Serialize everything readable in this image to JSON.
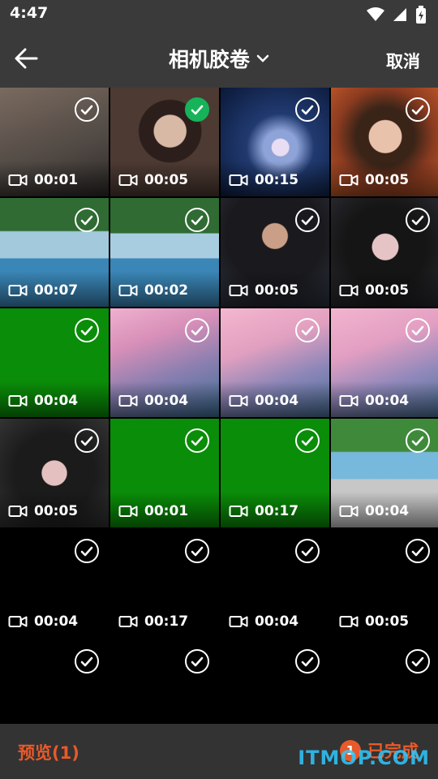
{
  "status_bar": {
    "time": "4:47"
  },
  "header": {
    "title": "相机胶卷",
    "cancel_label": "取消"
  },
  "tiles": [
    {
      "duration": "00:01",
      "selected": false
    },
    {
      "duration": "00:05",
      "selected": true
    },
    {
      "duration": "00:15",
      "selected": false
    },
    {
      "duration": "00:05",
      "selected": false
    },
    {
      "duration": "00:07",
      "selected": false
    },
    {
      "duration": "00:02",
      "selected": false
    },
    {
      "duration": "00:05",
      "selected": false
    },
    {
      "duration": "00:05",
      "selected": false
    },
    {
      "duration": "00:04",
      "selected": false
    },
    {
      "duration": "00:04",
      "selected": false
    },
    {
      "duration": "00:04",
      "selected": false
    },
    {
      "duration": "00:04",
      "selected": false
    },
    {
      "duration": "00:05",
      "selected": false
    },
    {
      "duration": "00:01",
      "selected": false
    },
    {
      "duration": "00:17",
      "selected": false
    },
    {
      "duration": "00:04",
      "selected": false
    },
    {
      "duration": "00:04",
      "selected": false
    },
    {
      "duration": "00:17",
      "selected": false
    },
    {
      "duration": "00:04",
      "selected": false
    },
    {
      "duration": "00:05",
      "selected": false
    },
    {
      "duration": "",
      "selected": false
    },
    {
      "duration": "",
      "selected": false
    },
    {
      "duration": "",
      "selected": false
    },
    {
      "duration": "",
      "selected": false
    }
  ],
  "bottom_bar": {
    "preview_label": "预览(1)",
    "done_count": "1",
    "done_label": "已完成"
  },
  "watermark": "ITMOP.COM",
  "colors": {
    "accent": "#e85a2a",
    "selected": "#17b35a",
    "bar": "#3a3a3a"
  }
}
